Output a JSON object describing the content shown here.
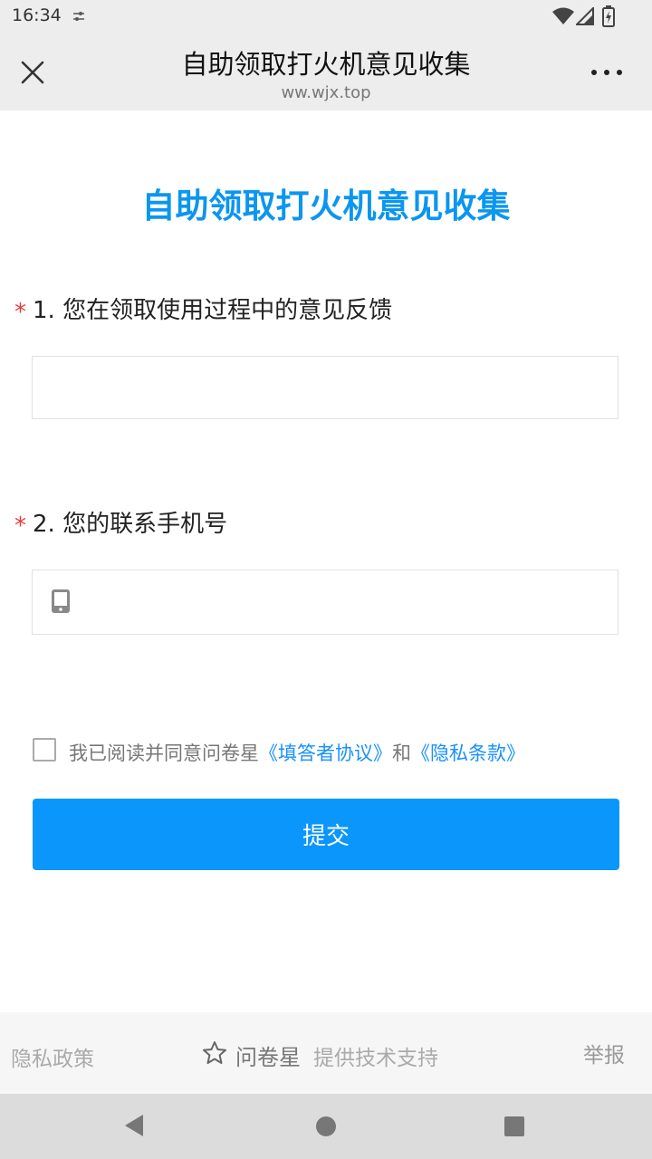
{
  "status_bar": {
    "time": "16:34"
  },
  "header": {
    "title": "自助领取打火机意见收集",
    "url": "ww.wjx.top"
  },
  "form": {
    "title": "自助领取打火机意见收集",
    "questions": [
      {
        "required_mark": "*",
        "label": "1. 您在领取使用过程中的意见反馈",
        "value": ""
      },
      {
        "required_mark": "*",
        "label": "2. 您的联系手机号",
        "value": ""
      }
    ],
    "agreement": {
      "text": "我已阅读并同意问卷星",
      "link1": "《填答者协议》",
      "and": "和",
      "link2": "《隐私条款》"
    },
    "submit_label": "提交"
  },
  "footer": {
    "privacy": "隐私政策",
    "brand": "问卷星",
    "support": "提供技术支持",
    "report": "举报"
  },
  "colors": {
    "accent": "#0b96fb",
    "title": "#0b96f0",
    "required": "#e63c3c",
    "link": "#1890ff"
  }
}
